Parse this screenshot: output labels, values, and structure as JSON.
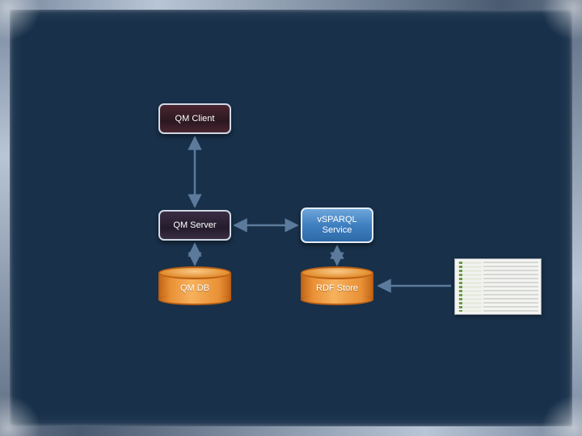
{
  "nodes": {
    "qm_client": "QM Client",
    "qm_server": "QM Server",
    "vsparql": "vSPARQL Service",
    "qm_db": "QM DB",
    "rdf_store": "RDF Store"
  },
  "colors": {
    "background": "#18304a",
    "node_dark_fill": "#2f2030",
    "node_blue_fill": "#4a86c6",
    "cylinder_fill": "#e99035",
    "arrow": "#5c7a9c"
  },
  "arrows": [
    {
      "from": "qm_client",
      "to": "qm_server",
      "bidirectional": true
    },
    {
      "from": "qm_server",
      "to": "vsparql",
      "bidirectional": true
    },
    {
      "from": "qm_server",
      "to": "qm_db",
      "bidirectional": true
    },
    {
      "from": "vsparql",
      "to": "rdf_store",
      "bidirectional": true
    },
    {
      "from": "external_ui",
      "to": "rdf_store",
      "bidirectional": false
    }
  ],
  "chart_data": {
    "type": "diagram",
    "title": "",
    "nodes": [
      {
        "id": "qm_client",
        "label": "QM Client",
        "shape": "rounded-rect",
        "fill": "dark-red"
      },
      {
        "id": "qm_server",
        "label": "QM Server",
        "shape": "rounded-rect",
        "fill": "dark-violet"
      },
      {
        "id": "vsparql",
        "label": "vSPARQL Service",
        "shape": "rounded-rect",
        "fill": "blue"
      },
      {
        "id": "qm_db",
        "label": "QM DB",
        "shape": "cylinder",
        "fill": "orange"
      },
      {
        "id": "rdf_store",
        "label": "RDF Store",
        "shape": "cylinder",
        "fill": "orange"
      },
      {
        "id": "external_ui",
        "label": "",
        "shape": "screenshot-thumbnail",
        "fill": "grey"
      }
    ],
    "edges": [
      {
        "source": "qm_client",
        "target": "qm_server",
        "type": "bidirectional"
      },
      {
        "source": "qm_server",
        "target": "vsparql",
        "type": "bidirectional"
      },
      {
        "source": "qm_server",
        "target": "qm_db",
        "type": "bidirectional"
      },
      {
        "source": "vsparql",
        "target": "rdf_store",
        "type": "bidirectional"
      },
      {
        "source": "external_ui",
        "target": "rdf_store",
        "type": "unidirectional"
      }
    ]
  }
}
